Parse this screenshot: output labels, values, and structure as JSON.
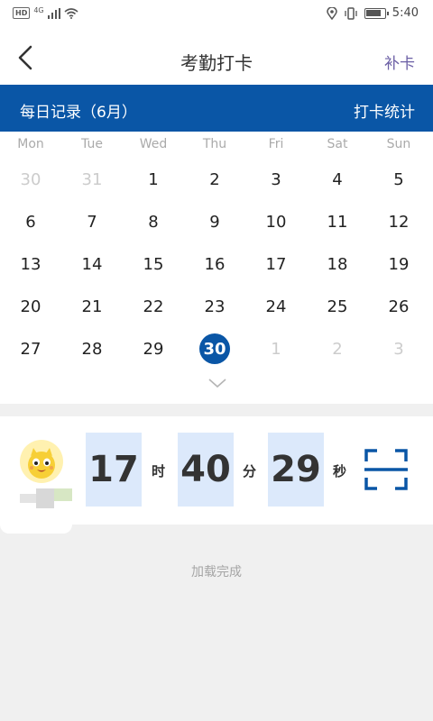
{
  "status_bar": {
    "hd": "HD",
    "network": "4G",
    "time": "5:40"
  },
  "header": {
    "title": "考勤打卡",
    "action": "补卡"
  },
  "banner": {
    "record_label": "每日记录（6月）",
    "stats_label": "打卡统计"
  },
  "calendar": {
    "weekdays": [
      "Mon",
      "Tue",
      "Wed",
      "Thu",
      "Fri",
      "Sat",
      "Sun"
    ],
    "weeks": [
      [
        "30",
        "31",
        "1",
        "2",
        "3",
        "4",
        "5"
      ],
      [
        "6",
        "7",
        "8",
        "9",
        "10",
        "11",
        "12"
      ],
      [
        "13",
        "14",
        "15",
        "16",
        "17",
        "18",
        "19"
      ],
      [
        "20",
        "21",
        "22",
        "23",
        "24",
        "25",
        "26"
      ],
      [
        "27",
        "28",
        "29",
        "30",
        "1",
        "2",
        "3"
      ]
    ],
    "selected_day": "30"
  },
  "clock": {
    "hours": "17",
    "hours_unit": "时",
    "minutes": "40",
    "minutes_unit": "分",
    "seconds": "29",
    "seconds_unit": "秒"
  },
  "footer": {
    "loading_text": "加载完成"
  },
  "colors": {
    "primary": "#0a56a6",
    "time_box": "#dce9fb",
    "accent_text": "#6b5fa5"
  }
}
